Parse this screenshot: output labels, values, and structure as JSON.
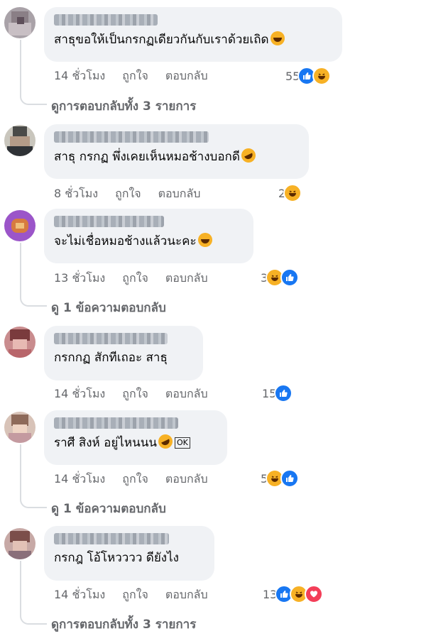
{
  "colors": {
    "like": "#1877f2",
    "haha": "#f7b125",
    "love": "#f33e58",
    "bubble": "#f0f2f5",
    "meta": "#65676b"
  },
  "labels": {
    "like": "ถูกใจ",
    "reply": "ตอบกลับ"
  },
  "comments": [
    {
      "text": "สาธุขอให้เป็นกรกฏเดียวกันกับเราด้วยเถิด",
      "emoji": "haha-icon",
      "time": "14 ชั่วโมง",
      "reaction_count": "55",
      "reactions": [
        "like-icon",
        "haha-icon"
      ],
      "replies": "ดูการตอบกลับทั้ง 3 รายการ"
    },
    {
      "text": "สาธุ กรกฏ พึ่งเคยเห็นหมอช้างบอกดี",
      "emoji": "rofl-icon",
      "time": "8 ชั่วโมง",
      "reaction_count": "2",
      "reactions": [
        "haha-icon"
      ],
      "replies": ""
    },
    {
      "text": "จะไม่เชื่อหมอช้างแล้วนะคะ",
      "emoji": "haha-icon",
      "time": "13 ชั่วโมง",
      "reaction_count": "3",
      "reactions": [
        "haha-icon",
        "like-icon"
      ],
      "replies": "ดู 1 ข้อความตอบกลับ"
    },
    {
      "text": "กรกกฏ สักทีเถอะ สาธุ",
      "emoji": "",
      "time": "14 ชั่วโมง",
      "reaction_count": "15",
      "reactions": [
        "like-icon"
      ],
      "replies": ""
    },
    {
      "text": "ราศี สิงห์ อยู่ไหนนน",
      "emoji": "rofl-icon",
      "extra": "OK",
      "time": "14 ชั่วโมง",
      "reaction_count": "5",
      "reactions": [
        "haha-icon",
        "like-icon"
      ],
      "replies": "ดู 1 ข้อความตอบกลับ"
    },
    {
      "text": "กรกฎ โอ้โหวววว ดียังไง",
      "emoji": "",
      "time": "14 ชั่วโมง",
      "reaction_count": "13",
      "reactions": [
        "like-icon",
        "haha-icon",
        "love-icon"
      ],
      "replies": "ดูการตอบกลับทั้ง 3 รายการ"
    }
  ]
}
